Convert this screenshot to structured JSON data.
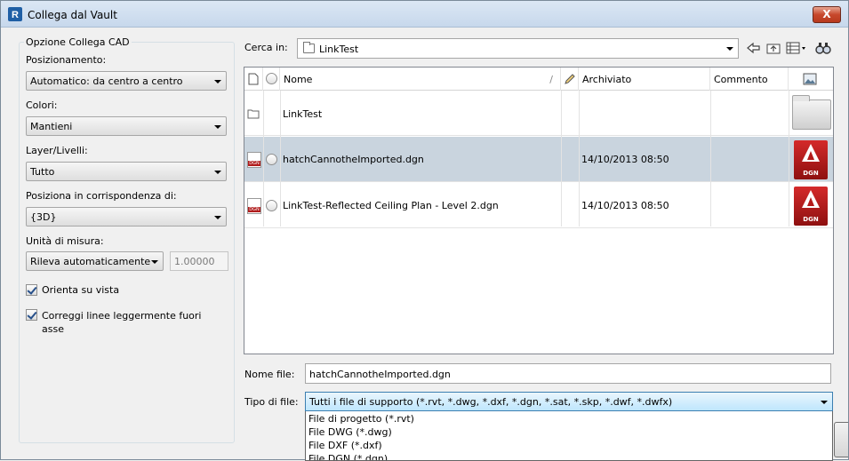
{
  "window": {
    "title": "Collega dal Vault",
    "close_label": "X"
  },
  "options": {
    "group_title": "Opzione Collega CAD",
    "positioning": {
      "label": "Posizionamento:",
      "value": "Automatico: da centro a centro"
    },
    "colors": {
      "label": "Colori:",
      "value": "Mantieni"
    },
    "layers": {
      "label": "Layer/Livelli:",
      "value": "Tutto"
    },
    "place_at": {
      "label": "Posiziona in corrispondenza di:",
      "value": "{3D}"
    },
    "units": {
      "label": "Unità di misura:",
      "value": "Rileva automaticamente",
      "scale": "1.00000"
    },
    "orient_to_view": {
      "label": "Orienta su vista",
      "checked": true
    },
    "correct_lines": {
      "label": "Correggi linee leggermente fuori asse",
      "checked": true
    }
  },
  "lookin": {
    "label": "Cerca in:",
    "value": "LinkTest"
  },
  "toolbar": {
    "icons": [
      "back-icon",
      "up-folder-icon",
      "views-icon",
      "find-icon"
    ]
  },
  "file_list": {
    "columns": {
      "name": "Nome",
      "checked_in": "Archiviato",
      "comment": "Commento"
    },
    "rows": [
      {
        "type": "folder",
        "name": "LinkTest",
        "checked_in": "",
        "comment": "",
        "thumb_label": ""
      },
      {
        "type": "dgn",
        "name": "hatchCannotheImported.dgn",
        "checked_in": "14/10/2013 08:50",
        "comment": "",
        "thumb_label": "DGN"
      },
      {
        "type": "dgn",
        "name": "LinkTest-Reflected Ceiling Plan - Level 2.dgn",
        "checked_in": "14/10/2013 08:50",
        "comment": "",
        "thumb_label": "DGN"
      }
    ]
  },
  "filename": {
    "label": "Nome file:",
    "value": "hatchCannotheImported.dgn"
  },
  "filetype": {
    "label": "Tipo di file:",
    "value": "Tutti i file di supporto (*.rvt, *.dwg, *.dxf, *.dgn, *.sat, *.skp, *.dwf, *.dwfx)",
    "options": [
      "File di progetto (*.rvt)",
      "File DWG (*.dwg)",
      "File DXF (*.dxf)",
      "File DGN (*.dgn)"
    ]
  },
  "colors": {
    "selected_row": "#c9d4de",
    "dgn_red": "#b01c1c"
  }
}
